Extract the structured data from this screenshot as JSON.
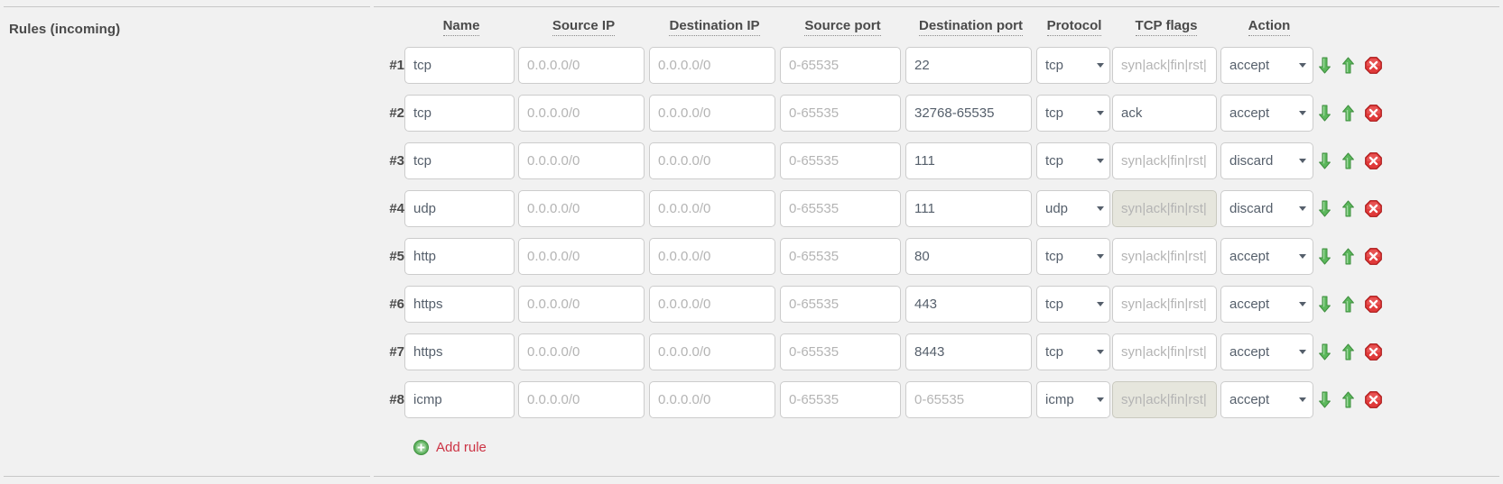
{
  "section": {
    "title": "Rules (incoming)"
  },
  "table": {
    "headers": {
      "index": "",
      "name": "Name",
      "source_ip": "Source IP",
      "destination_ip": "Destination IP",
      "source_port": "Source port",
      "destination_port": "Destination port",
      "protocol": "Protocol",
      "tcp_flags": "TCP flags",
      "action": "Action"
    },
    "placeholders": {
      "name": "",
      "source_ip": "0.0.0.0/0",
      "destination_ip": "0.0.0.0/0",
      "source_port": "0-65535",
      "destination_port": "0-65535",
      "tcp_flags": "syn|ack|fin|rst|"
    },
    "rows": [
      {
        "index": "#1",
        "name": "tcp",
        "source_ip": "",
        "destination_ip": "",
        "source_port": "",
        "destination_port": "22",
        "protocol": "tcp",
        "tcp_flags": "",
        "tcp_flags_disabled": false,
        "action": "accept"
      },
      {
        "index": "#2",
        "name": "tcp",
        "source_ip": "",
        "destination_ip": "",
        "source_port": "",
        "destination_port": "32768-65535",
        "protocol": "tcp",
        "tcp_flags": "ack",
        "tcp_flags_disabled": false,
        "action": "accept"
      },
      {
        "index": "#3",
        "name": "tcp",
        "source_ip": "",
        "destination_ip": "",
        "source_port": "",
        "destination_port": "111",
        "protocol": "tcp",
        "tcp_flags": "",
        "tcp_flags_disabled": false,
        "action": "discard"
      },
      {
        "index": "#4",
        "name": "udp",
        "source_ip": "",
        "destination_ip": "",
        "source_port": "",
        "destination_port": "111",
        "protocol": "udp",
        "tcp_flags": "",
        "tcp_flags_disabled": true,
        "action": "discard"
      },
      {
        "index": "#5",
        "name": "http",
        "source_ip": "",
        "destination_ip": "",
        "source_port": "",
        "destination_port": "80",
        "protocol": "tcp",
        "tcp_flags": "",
        "tcp_flags_disabled": false,
        "action": "accept"
      },
      {
        "index": "#6",
        "name": "https",
        "source_ip": "",
        "destination_ip": "",
        "source_port": "",
        "destination_port": "443",
        "protocol": "tcp",
        "tcp_flags": "",
        "tcp_flags_disabled": false,
        "action": "accept"
      },
      {
        "index": "#7",
        "name": "https",
        "source_ip": "",
        "destination_ip": "",
        "source_port": "",
        "destination_port": "8443",
        "protocol": "tcp",
        "tcp_flags": "",
        "tcp_flags_disabled": false,
        "action": "accept"
      },
      {
        "index": "#8",
        "name": "icmp",
        "source_ip": "",
        "destination_ip": "",
        "source_port": "",
        "destination_port": "",
        "protocol": "icmp",
        "tcp_flags": "",
        "tcp_flags_disabled": true,
        "action": "accept"
      }
    ],
    "row_ops": {
      "move_down": "move-down-icon",
      "move_up": "move-up-icon",
      "delete": "delete-icon"
    }
  },
  "add_rule": {
    "label": "Add rule",
    "icon": "plus-circle-icon"
  },
  "colors": {
    "page_background": "#f1f1f1",
    "field_border": "#cccccc",
    "field_background": "#ffffff",
    "field_disabled_background": "#e6e6dd",
    "text": "#555f6b",
    "placeholder_text": "#b4b4b4",
    "heading_text": "#4a4a4a",
    "link_red": "#cc3344",
    "icon_green": "#4caf50",
    "icon_red": "#e02020"
  }
}
